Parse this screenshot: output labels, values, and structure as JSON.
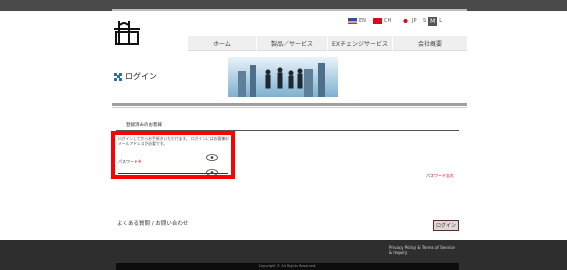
{
  "header": {
    "languages": [
      {
        "code": "EN",
        "flag": "us"
      },
      {
        "code": "CH",
        "flag": "cn"
      },
      {
        "code": "JP",
        "flag": "jp"
      }
    ],
    "size_options": [
      "S",
      "M",
      "L"
    ]
  },
  "nav": {
    "items": [
      "ホーム",
      "製品／サービス",
      "EXチェンジサービス",
      "会社概要"
    ]
  },
  "page": {
    "title": "ログイン"
  },
  "login": {
    "section_title": "登録済みのお客様",
    "description": "ログインしてからお手続きいただけます。 ログインにはお客様のメールアドレスが必要です。",
    "password_label": "パスワード",
    "required_mark": "※",
    "forgot_link": "パスワード忘れ",
    "faq_text": "よくある質問 / お問い合わせ",
    "login_button": "ログイン"
  },
  "footer": {
    "links_line1": "Privacy Policy & Terms of Service",
    "links_line2": "& Inquiry",
    "copyright": "Copyright © All Rights Reserved."
  },
  "colors": {
    "accent": "#2b6fb3",
    "highlight": "#ff0000",
    "footer_bg": "#2e2e2e"
  }
}
